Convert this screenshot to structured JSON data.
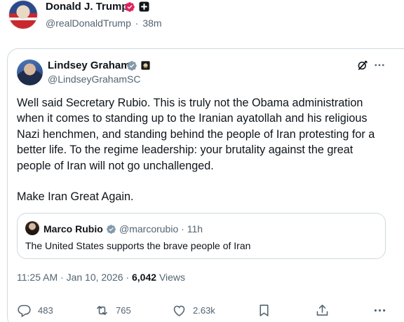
{
  "repost_author": {
    "name": "Donald J. Trump",
    "handle": "@realDonaldTrump",
    "separator": "·",
    "time": "38m",
    "colors": {
      "verified_badge": "#e0245e"
    }
  },
  "post": {
    "author_name": "Lindsey Graham",
    "author_handle": "@LindseyGrahamSC",
    "paragraph_1": "Well said Secretary Rubio. This is truly not the Obama administration when it comes to standing up to the Iranian ayatollah and his religious Nazi henchmen, and standing behind the people of Iran protesting for a better life. To the regime leadership: your brutality against the great people of Iran will not go unchallenged.",
    "paragraph_2": "Make Iran Great Again.",
    "colors": {
      "verified_badge": "#829aab"
    }
  },
  "quote": {
    "author_name": "Marco Rubio",
    "author_handle": "@marcorubio",
    "separator": "·",
    "time": "11h",
    "text": "The United States supports the brave people of Iran"
  },
  "meta": {
    "time": "11:25 AM",
    "date": "Jan 10, 2026",
    "views_count": "6,042",
    "views_label": "Views",
    "separator": "·"
  },
  "actions": {
    "replies": "483",
    "reposts": "765",
    "likes": "2.63k"
  },
  "icons": [
    "grok-icon",
    "more-icon",
    "reply-icon",
    "repost-icon",
    "like-icon",
    "bookmark-icon",
    "share-icon",
    "more-icon"
  ]
}
